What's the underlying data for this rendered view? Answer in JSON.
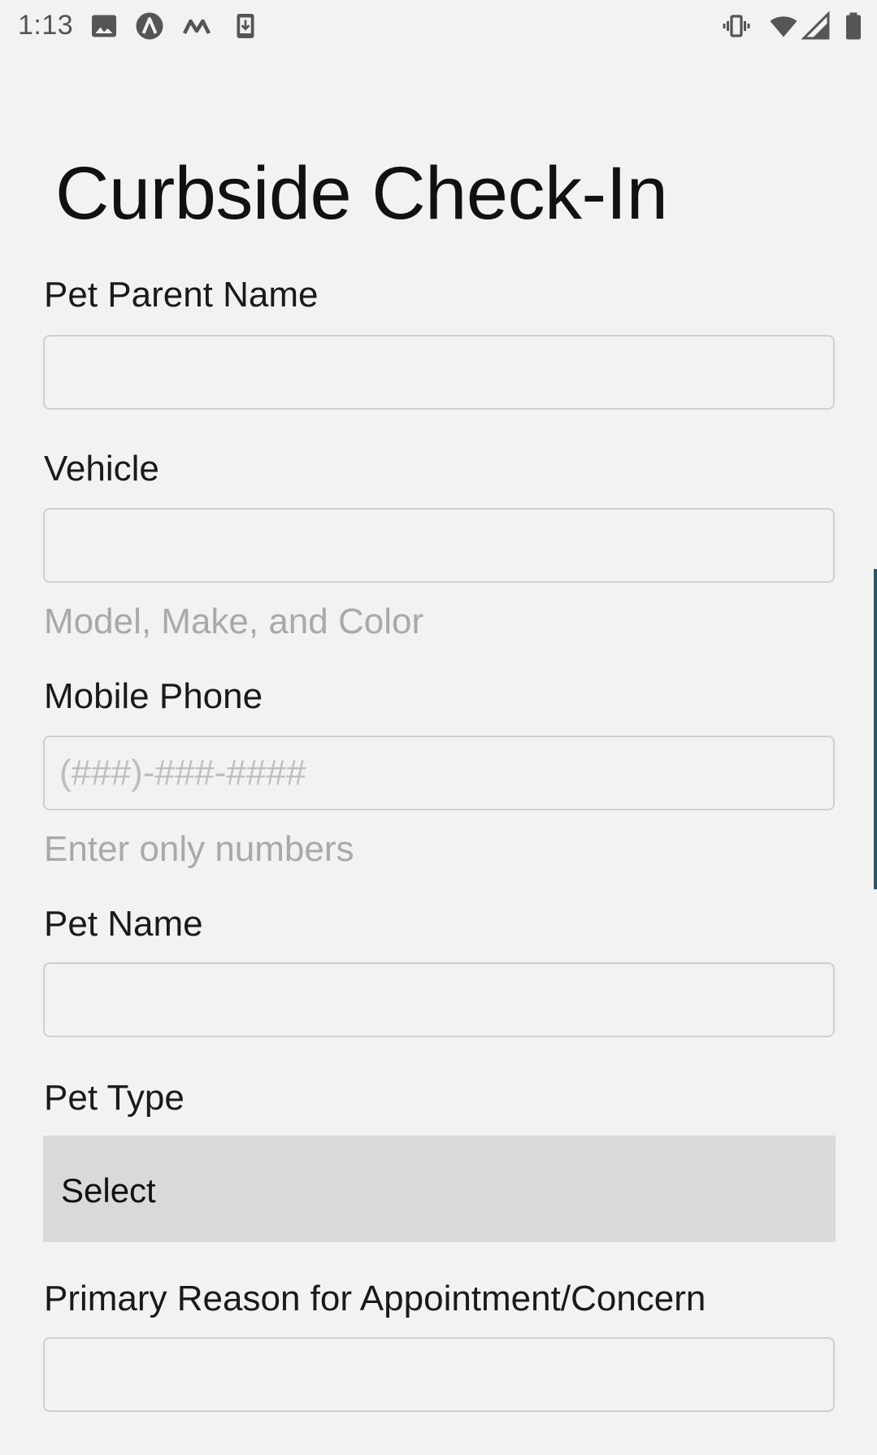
{
  "status_bar": {
    "time": "1:13",
    "left_icons": [
      "image-icon",
      "a-circle-icon",
      "m-logo-icon",
      "download-icon"
    ],
    "right_icons": [
      "vibrate-icon",
      "wifi-icon",
      "signal-icon",
      "battery-icon"
    ]
  },
  "page": {
    "title": "Curbside Check-In"
  },
  "form": {
    "pet_parent_name": {
      "label": "Pet Parent Name",
      "value": "",
      "placeholder": ""
    },
    "vehicle": {
      "label": "Vehicle",
      "value": "",
      "placeholder": "",
      "helper": "Model, Make, and Color"
    },
    "mobile_phone": {
      "label": "Mobile Phone",
      "value": "",
      "placeholder": "(###)-###-####",
      "helper": "Enter only numbers"
    },
    "pet_name": {
      "label": "Pet Name",
      "value": "",
      "placeholder": ""
    },
    "pet_type": {
      "label": "Pet Type",
      "selected": "Select"
    },
    "primary_reason": {
      "label": "Primary Reason for Appointment/Concern",
      "value": "",
      "placeholder": ""
    }
  },
  "colors": {
    "background": "#f2f2f2",
    "input_border": "#cfcfcf",
    "select_background": "#d9d9d9",
    "helper_text": "#a9a9a9",
    "scroll_indicator": "#1f5b73"
  }
}
